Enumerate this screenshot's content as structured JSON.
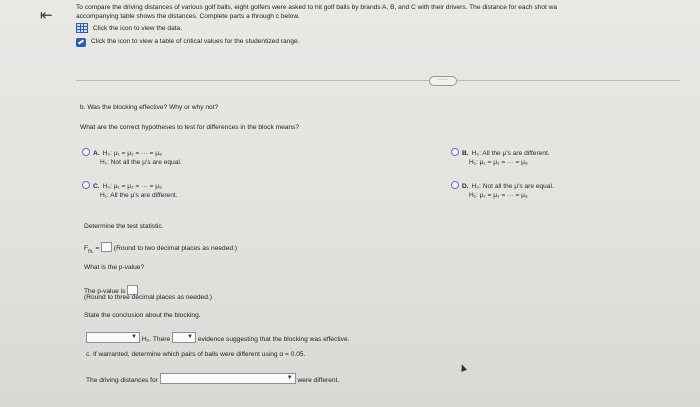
{
  "nav": {
    "back_icon": "⇤"
  },
  "intro": {
    "line1": "To compare the driving distances of various golf balls, eight golfers were asked to hit golf balls by brands A, B, and C with their drivers. The distance for each shot wa",
    "line2": "accompanying table shows the distances. Complete parts a through c below.",
    "link_table": "Click the icon to view the data.",
    "link_critical": "Click the icon to view a table of critical values for the studentized range."
  },
  "more_pill": "·····",
  "part_b": {
    "question": "b. Was the blocking effective? Why or why not?",
    "hyp_prompt": "What are the correct hypotheses to test for differences in the block means?",
    "options": {
      "A": {
        "letter": "A.",
        "h0": "H₀: μ₁ = μ₂ = ··· = μ₈",
        "h1": "H₁: Not all the μ's are equal."
      },
      "B": {
        "letter": "B.",
        "h0": "H₀: All the μ's are different.",
        "h1": "H₁: μ₁ = μ₂ = ··· = μ₈"
      },
      "C": {
        "letter": "C.",
        "h0": "H₀: μ₁ = μ₂ = ··· = μ₈",
        "h1": "H₁: All the μ's are different."
      },
      "D": {
        "letter": "D.",
        "h0": "H₀: Not all the μ's are equal.",
        "h1": "H₁: μ₁ = μ₂ = ··· = μ₈"
      }
    },
    "test_stat_prompt": "Determine the test statistic.",
    "fbl_label": "F",
    "fbl_sub": "BL",
    "fbl_eq": " =",
    "fbl_hint": "(Round to two decimal places as needed.)",
    "pvalue_prompt": "What is the p-value?",
    "pvalue_label": "The p-value is",
    "pvalue_hint": "(Round to three decimal places as needed.)",
    "conclusion_prompt": "State the conclusion about the blocking.",
    "h0_there": "H₀. There",
    "evidence_text": "evidence suggesting that the blocking was effective."
  },
  "part_c": {
    "question": "c. If warranted, determine which pairs of balls were different using α = 0.05.",
    "distances_label": "The driving distances for",
    "were_different": "were different."
  },
  "colors": {
    "link_blue": "#2c5fa7"
  }
}
